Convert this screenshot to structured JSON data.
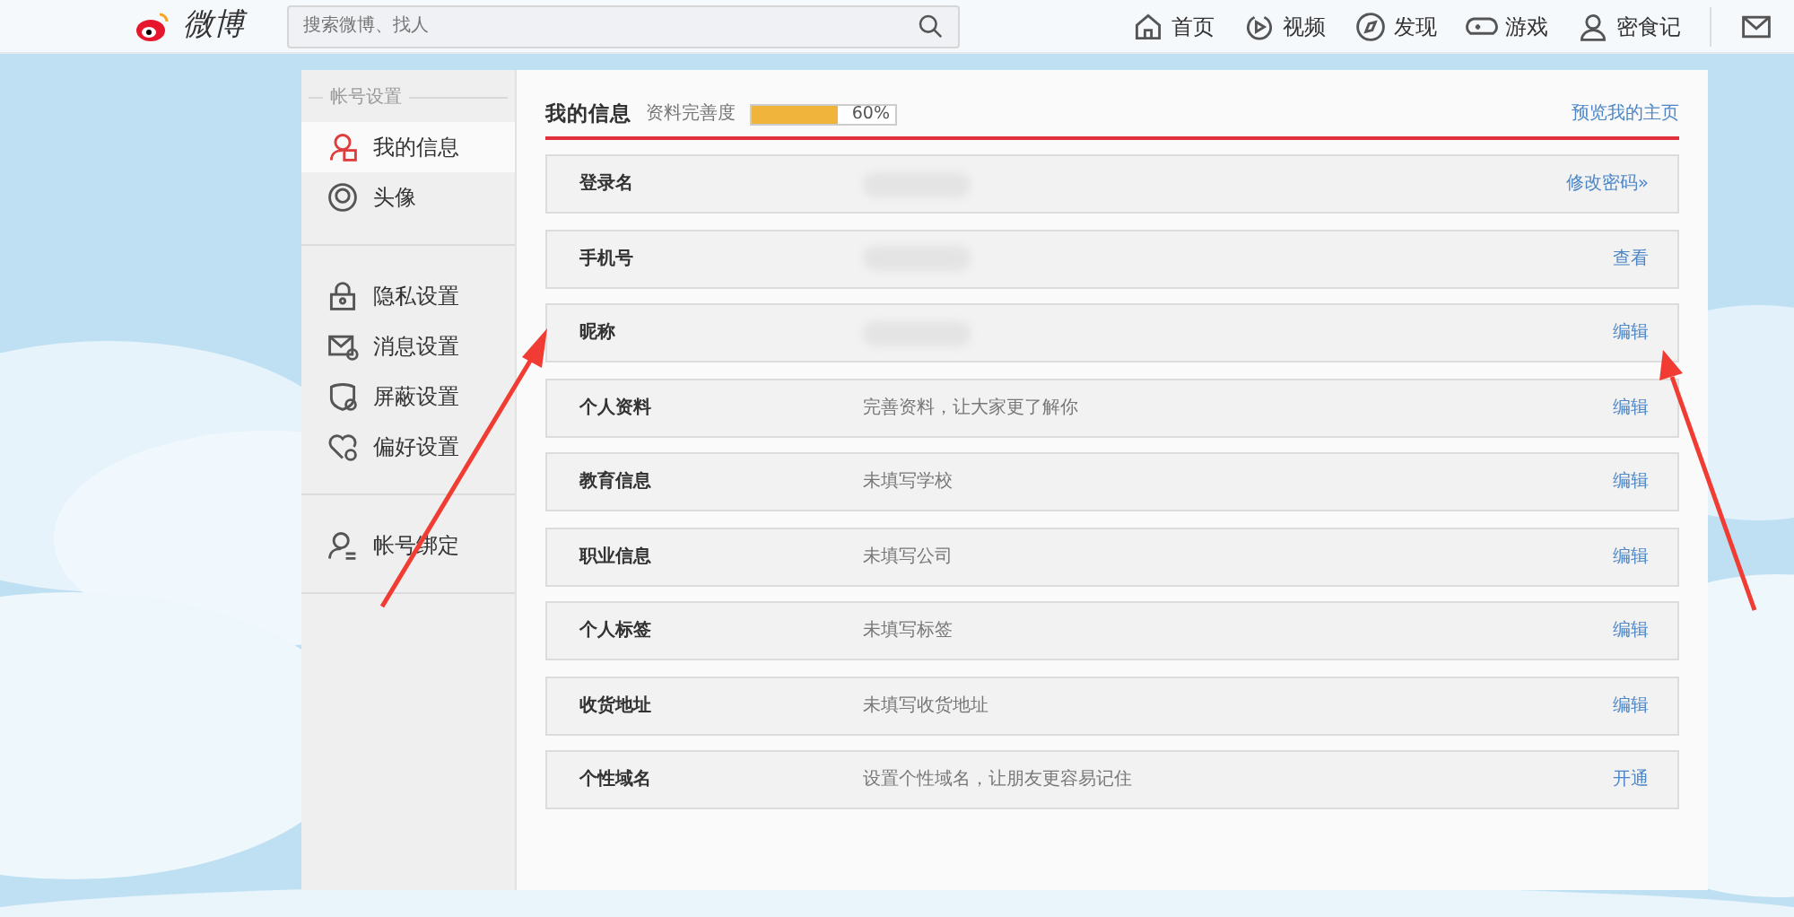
{
  "header": {
    "logo": "微博",
    "search": {
      "placeholder": "搜索微博、找人"
    },
    "nav": [
      {
        "label": "首页"
      },
      {
        "label": "视频"
      },
      {
        "label": "发现"
      },
      {
        "label": "游戏"
      },
      {
        "label": "密食记"
      }
    ]
  },
  "sidebar": {
    "heading": "帐号设置",
    "groups": [
      [
        {
          "label": "我的信息",
          "selected": true
        },
        {
          "label": "头像",
          "selected": false
        }
      ],
      [
        {
          "label": "隐私设置",
          "selected": false
        },
        {
          "label": "消息设置",
          "selected": false
        },
        {
          "label": "屏蔽设置",
          "selected": false
        },
        {
          "label": "偏好设置",
          "selected": false
        }
      ],
      [
        {
          "label": "帐号绑定",
          "selected": false
        }
      ]
    ]
  },
  "content": {
    "title": "我的信息",
    "completeness": {
      "label": "资料完善度",
      "level": 0.6,
      "reading": "60%"
    },
    "preview_link": "预览我的主页",
    "rows": [
      {
        "label": "登录名",
        "redacted": true,
        "action": "修改密码»"
      },
      {
        "label": "手机号",
        "redacted": true,
        "action": "查看"
      },
      {
        "label": "昵称",
        "redacted": true,
        "action": "编辑"
      },
      {
        "label": "个人资料",
        "redacted": false,
        "value": "完善资料，让大家更了解你",
        "action": "编辑"
      },
      {
        "label": "教育信息",
        "redacted": false,
        "value": "未填写学校",
        "action": "编辑"
      },
      {
        "label": "职业信息",
        "redacted": false,
        "value": "未填写公司",
        "action": "编辑"
      },
      {
        "label": "个人标签",
        "redacted": false,
        "value": "未填写标签",
        "action": "编辑"
      },
      {
        "label": "收货地址",
        "redacted": false,
        "value": "未填写收货地址",
        "action": "编辑"
      },
      {
        "label": "个性域名",
        "redacted": false,
        "value": "设置个性域名，让朋友更容易记住",
        "action": "开通"
      }
    ]
  }
}
